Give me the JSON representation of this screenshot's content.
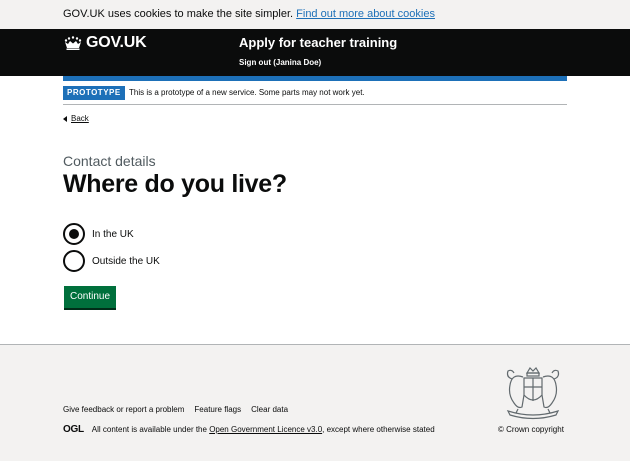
{
  "cookie_banner": {
    "text": "GOV.UK uses cookies to make the site simpler.",
    "link": "Find out more about cookies"
  },
  "header": {
    "logo_text": "GOV.UK",
    "service_name": "Apply for teacher training",
    "sign_out": "Sign out (Janina Doe)"
  },
  "phase_banner": {
    "tag": "PROTOTYPE",
    "text": "This is a prototype of a new service. Some parts may not work yet."
  },
  "back_link": "Back",
  "form": {
    "caption": "Contact details",
    "heading": "Where do you live?",
    "options": [
      {
        "label": "In the UK",
        "checked": true
      },
      {
        "label": "Outside the UK",
        "checked": false
      }
    ],
    "continue_label": "Continue"
  },
  "footer": {
    "links": [
      "Give feedback or report a problem",
      "Feature flags",
      "Clear data"
    ],
    "ogl_logo": "OGL",
    "licence_prefix": "All content is available under the",
    "licence_link": "Open Government Licence v3.0",
    "licence_suffix": ", except where otherwise stated",
    "copyright": "© Crown copyright"
  },
  "colors": {
    "brand_blue": "#1d70b8",
    "header_black": "#0b0c0c",
    "button_green": "#00703c",
    "footer_grey": "#f3f2f1"
  },
  "icons": [
    "crown-icon",
    "back-arrow-icon",
    "royal-crest-icon"
  ]
}
